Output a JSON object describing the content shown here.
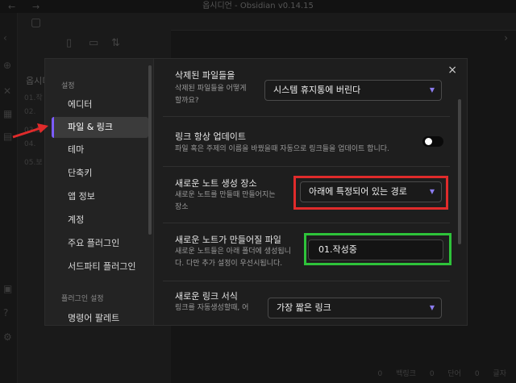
{
  "window": {
    "title": "옵시디언 - Obsidian v0.14.15"
  },
  "background": {
    "vault_name": "옵시디",
    "files": [
      "01.작",
      "02.",
      "03.도",
      "04.",
      "05.보"
    ],
    "status": [
      "0 백링크",
      "0 단어",
      "0 글자"
    ]
  },
  "modal": {
    "sidebar": {
      "section1": "설정",
      "items": [
        "에디터",
        "파일 & 링크",
        "테마",
        "단축키",
        "앱 정보",
        "계정",
        "주요 플러그인",
        "서드파티 플러그인"
      ],
      "active_item": "파일 & 링크",
      "section2": "플러그인 설정",
      "plugin_items": [
        "명령어 팔레트"
      ]
    },
    "settings": [
      {
        "name": "삭제된 파일들을",
        "desc": [
          "삭제된 파일들을 어떻게",
          "할까요?"
        ],
        "control": "select",
        "value": "시스템 휴지통에 버린다"
      },
      {
        "name": "링크 항상 업데이트",
        "desc": [
          "파일 혹은 주제의 이름을 바꿨을때 자동으로 링크들을 업데이트 합니다."
        ],
        "control": "toggle",
        "value": "on"
      },
      {
        "name": "새로운 노트 생성 장소",
        "desc": [
          "새로운 노트를 만들때 만들어지는",
          "장소"
        ],
        "control": "select",
        "value": "아래에 특정되어 있는 경로"
      },
      {
        "name": "새로운 노트가 만들어질 파일",
        "desc": [
          "새로운 노트들은 아래 폴더에 생성됩니",
          "다. 다만 추가 설정이 우선시됩니다."
        ],
        "control": "text",
        "value": "01.작성중"
      },
      {
        "name": "새로운 링크 서식",
        "desc": [
          "링크를 자동생성할때, 어"
        ],
        "control": "select",
        "value": "가장 짧은 링크"
      }
    ],
    "close_icon": "×"
  },
  "annotations": {
    "arrow_color": "#e02b2b",
    "red_box_color": "#e02b2b",
    "green_box_color": "#2ec33a"
  }
}
